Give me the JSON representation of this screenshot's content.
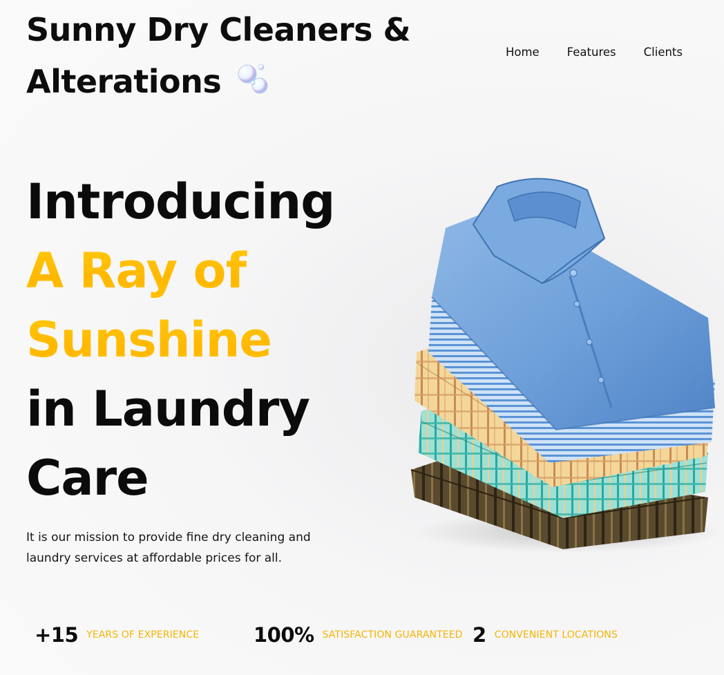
{
  "header": {
    "brand_line1": "Sunny Dry Cleaners &",
    "brand_line2": "Alterations",
    "brand_icon": "soap-bubbles-icon"
  },
  "nav": {
    "items": [
      {
        "label": "Home"
      },
      {
        "label": "Features"
      },
      {
        "label": "Clients"
      }
    ]
  },
  "hero": {
    "line1": "Introducing",
    "accent_line1": "A Ray of",
    "accent_line2": "Sunshine",
    "line4": "in Laundry",
    "line5": "Care",
    "accent_color": "#FFBE00",
    "mission": "It is our mission to provide fine dry cleaning and laundry services at affordable prices for all."
  },
  "image": {
    "subject": "stack-of-folded-shirts"
  },
  "stats": [
    {
      "value": "+15",
      "label": "YEARS OF EXPERIENCE"
    },
    {
      "value": "100%",
      "label": "SATISFACTION GUARANTEED"
    },
    {
      "value": "2",
      "label": "CONVENIENT LOCATIONS"
    }
  ],
  "colors": {
    "text": "#0B0B0B",
    "accent": "#F4B400",
    "background": "#F7F7F8"
  }
}
